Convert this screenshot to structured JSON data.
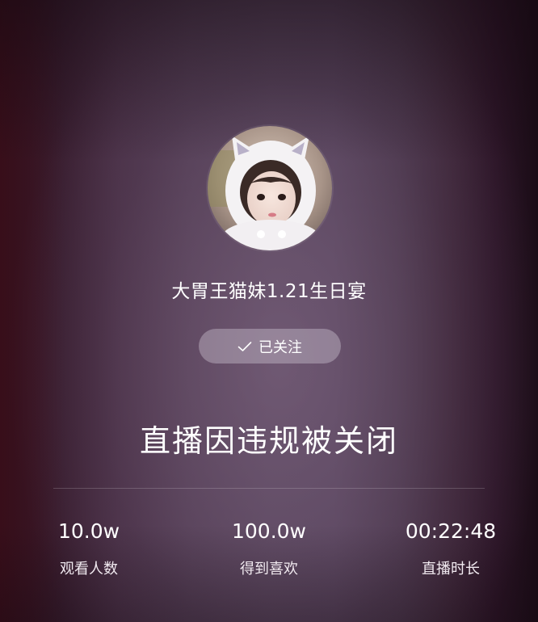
{
  "streamer": {
    "name": "大胃王猫妹1.21生日宴",
    "follow_label": "已关注",
    "follow_icon": "check-icon"
  },
  "status": {
    "title": "直播因违规被关闭"
  },
  "stats": [
    {
      "value": "10.0w",
      "label": "观看人数"
    },
    {
      "value": "100.0w",
      "label": "得到喜欢"
    },
    {
      "value": "00:22:48",
      "label": "直播时长"
    }
  ],
  "colors": {
    "background_center": "#5b4860",
    "background_edge": "#160b12",
    "follow_button_bg": "#cdc4d2",
    "text": "#ffffff"
  }
}
